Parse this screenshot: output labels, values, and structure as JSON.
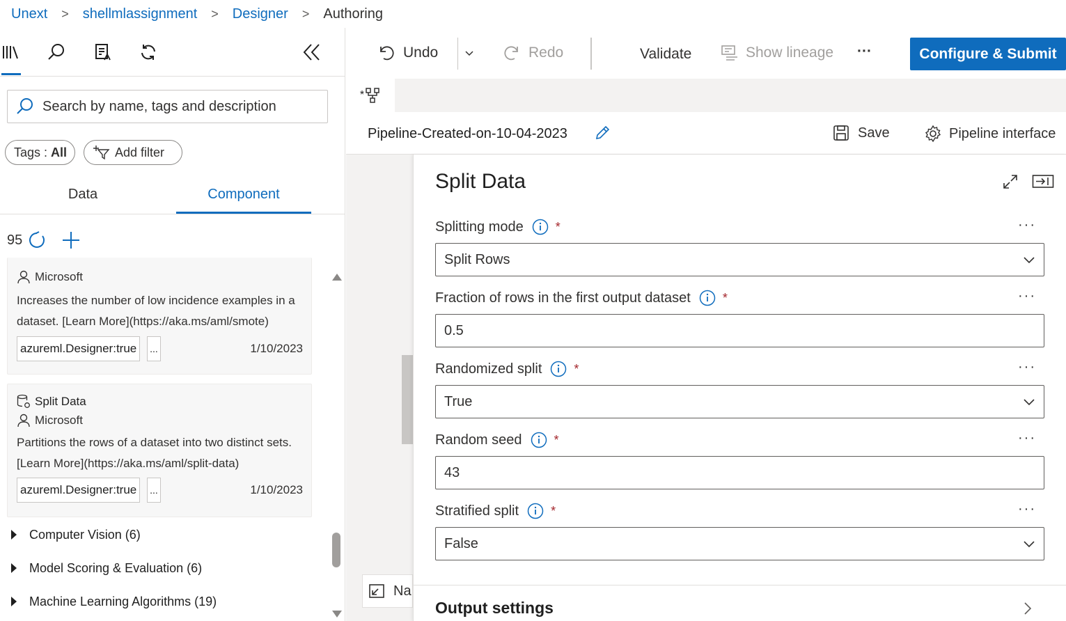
{
  "breadcrumb": {
    "items": [
      "Unext",
      "shellmlassignment",
      "Designer"
    ],
    "current": "Authoring",
    "separator": ">"
  },
  "left_panel": {
    "search_placeholder": "Search by name, tags and description",
    "tags_label": "Tags : ",
    "tags_value": "All",
    "add_filter": "Add filter",
    "tabs": [
      "Data",
      "Component"
    ],
    "active_tab": "Component",
    "count": "95",
    "cards": [
      {
        "publisher": "Microsoft",
        "description": "Increases the number of low incidence examples in a dataset. [Learn More](https://aka.ms/aml/smote)",
        "tag": "azureml.Designer:true",
        "more": "...",
        "date": "1/10/2023"
      },
      {
        "title": "Split Data",
        "publisher": "Microsoft",
        "description": "Partitions the rows of a dataset into two distinct sets. [Learn More](https://aka.ms/aml/split-data)",
        "tag": "azureml.Designer:true",
        "more": "...",
        "date": "1/10/2023"
      }
    ],
    "categories": [
      "Computer Vision (6)",
      "Model Scoring & Evaluation (6)",
      "Machine Learning Algorithms (19)"
    ]
  },
  "toolbar": {
    "undo": "Undo",
    "redo": "Redo",
    "validate": "Validate",
    "show_lineage": "Show lineage",
    "more": "···",
    "configure_submit": "Configure & Submit"
  },
  "tab_strip": {
    "pipeline_tab_prefix": "*"
  },
  "pipeline_header": {
    "name": "Pipeline-Created-on-10-04-2023",
    "save": "Save",
    "pipeline_interface": "Pipeline interface"
  },
  "canvas": {
    "navigator_label": "Na"
  },
  "properties": {
    "title": "Split Data",
    "fields": [
      {
        "label": "Splitting mode",
        "value": "Split Rows",
        "type": "dropdown",
        "required": "*"
      },
      {
        "label": "Fraction of rows in the first output dataset",
        "value": "0.5",
        "type": "text",
        "required": "*"
      },
      {
        "label": "Randomized split",
        "value": "True",
        "type": "dropdown",
        "required": "*"
      },
      {
        "label": "Random seed",
        "value": "43",
        "type": "text",
        "required": "*"
      },
      {
        "label": "Stratified split",
        "value": "False",
        "type": "dropdown",
        "required": "*"
      }
    ],
    "field_more": "···",
    "output_settings": "Output settings"
  },
  "colors": {
    "accent": "#0f6cbd",
    "required": "#a4262c",
    "canvas_bg": "#f3f2f1"
  }
}
